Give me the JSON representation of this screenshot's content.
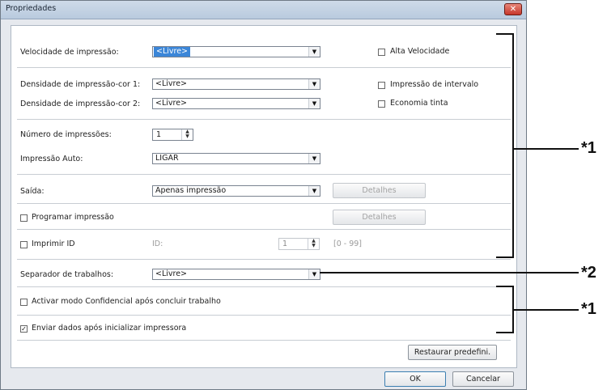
{
  "window": {
    "title": "Propriedades",
    "close_icon": "close-icon",
    "accent": "#c6372a"
  },
  "fields": {
    "speed_label": "Velocidade de impressão:",
    "speed_value": "<Livre>",
    "high_speed_label": "Alta Velocidade",
    "density1_label": "Densidade de impressão-cor 1:",
    "density1_value": "<Livre>",
    "density2_label": "Densidade de impressão-cor 2:",
    "density2_value": "<Livre>",
    "interval_label": "Impressão de intervalo",
    "economy_label": "Economia tinta",
    "copies_label": "Número de impressões:",
    "copies_value": "1",
    "auto_label": "Impressão Auto:",
    "auto_value": "LIGAR",
    "output_label": "Saída:",
    "output_value": "Apenas impressão",
    "details_label": "Detalhes",
    "schedule_label": "Programar impressão",
    "schedule_details_label": "Detalhes",
    "print_id_label": "Imprimir ID",
    "id_label": "ID:",
    "id_value": "1",
    "id_range": "[0 - 99]",
    "separator_label": "Separador de trabalhos:",
    "separator_value": "<Livre>",
    "confidential_label": "Activar modo Confidencial após concluir trabalho",
    "send_data_label": "Enviar dados após inicializar impressora",
    "send_data_checked": true
  },
  "buttons": {
    "restore": "Restaurar predefini.",
    "ok": "OK",
    "cancel": "Cancelar"
  },
  "annotations": {
    "a1": "*1",
    "a2": "*2",
    "a3": "*1"
  },
  "colors": {
    "selection": "#3b86d8",
    "titlebar": "#b9cade",
    "background": "#e6e9ee"
  }
}
